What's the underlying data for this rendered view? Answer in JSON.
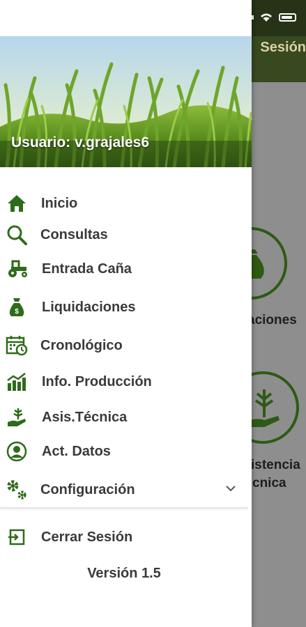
{
  "background": {
    "appbar_title": "Sesión",
    "card1_label": "aciones",
    "card2_label_line1": "istencia",
    "card2_label_line2": "cnica"
  },
  "drawer": {
    "user_label": "Usuario: v.grajales6",
    "items": [
      {
        "label": "Inicio",
        "icon": "home-icon"
      },
      {
        "label": "Consultas",
        "icon": "search-icon"
      },
      {
        "label": "Entrada Caña",
        "icon": "tractor-icon"
      },
      {
        "label": "Liquidaciones",
        "icon": "money-bag-icon"
      },
      {
        "label": "Cronológico",
        "icon": "calendar-clock-icon"
      },
      {
        "label": "Info. Producción",
        "icon": "bar-chart-icon"
      },
      {
        "label": "Asis.Técnica",
        "icon": "plant-hand-icon"
      },
      {
        "label": "Act. Datos",
        "icon": "user-circle-icon"
      },
      {
        "label": "Configuración",
        "icon": "gears-icon"
      }
    ],
    "logout_label": "Cerrar Sesión",
    "version": "Versión 1.5"
  },
  "colors": {
    "icon_green": "#2e6b1a",
    "appbar": "#38491f",
    "scrim": "#8e8e8e"
  }
}
